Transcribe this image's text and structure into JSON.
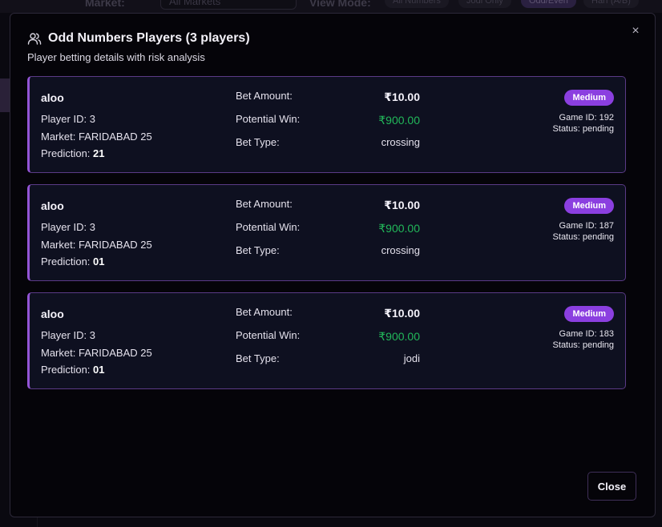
{
  "background": {
    "market_label": "Market:",
    "market_select_value": "All Markets",
    "view_mode_label": "View Mode:",
    "view_pills": [
      "All Numbers",
      "Jodi Only",
      "Odd/Even",
      "Harf (A/B)"
    ]
  },
  "modal": {
    "title": "Odd Numbers Players (3 players)",
    "subtitle": "Player betting details with risk analysis",
    "close_button_label": "Close",
    "close_x": "×",
    "icon": "users-icon",
    "colors": {
      "accent": "#8b3fe0",
      "win": "#22b85a",
      "card_border": "#5a3a86"
    }
  },
  "labels": {
    "player_id": "Player ID: ",
    "market": "Market: ",
    "prediction": "Prediction: ",
    "bet_amount": "Bet Amount:",
    "potential_win": "Potential Win:",
    "bet_type": "Bet Type:",
    "game_id": "Game ID: ",
    "status": "Status: "
  },
  "players": [
    {
      "name": "aloo",
      "player_id": "3",
      "market": "FARIDABAD 25",
      "prediction": "21",
      "bet_amount": "₹10.00",
      "potential_win": "₹900.00",
      "bet_type": "crossing",
      "risk": "Medium",
      "game_id": "192",
      "status": "pending"
    },
    {
      "name": "aloo",
      "player_id": "3",
      "market": "FARIDABAD 25",
      "prediction": "01",
      "bet_amount": "₹10.00",
      "potential_win": "₹900.00",
      "bet_type": "crossing",
      "risk": "Medium",
      "game_id": "187",
      "status": "pending"
    },
    {
      "name": "aloo",
      "player_id": "3",
      "market": "FARIDABAD 25",
      "prediction": "01",
      "bet_amount": "₹10.00",
      "potential_win": "₹900.00",
      "bet_type": "jodi",
      "risk": "Medium",
      "game_id": "183",
      "status": "pending"
    }
  ]
}
